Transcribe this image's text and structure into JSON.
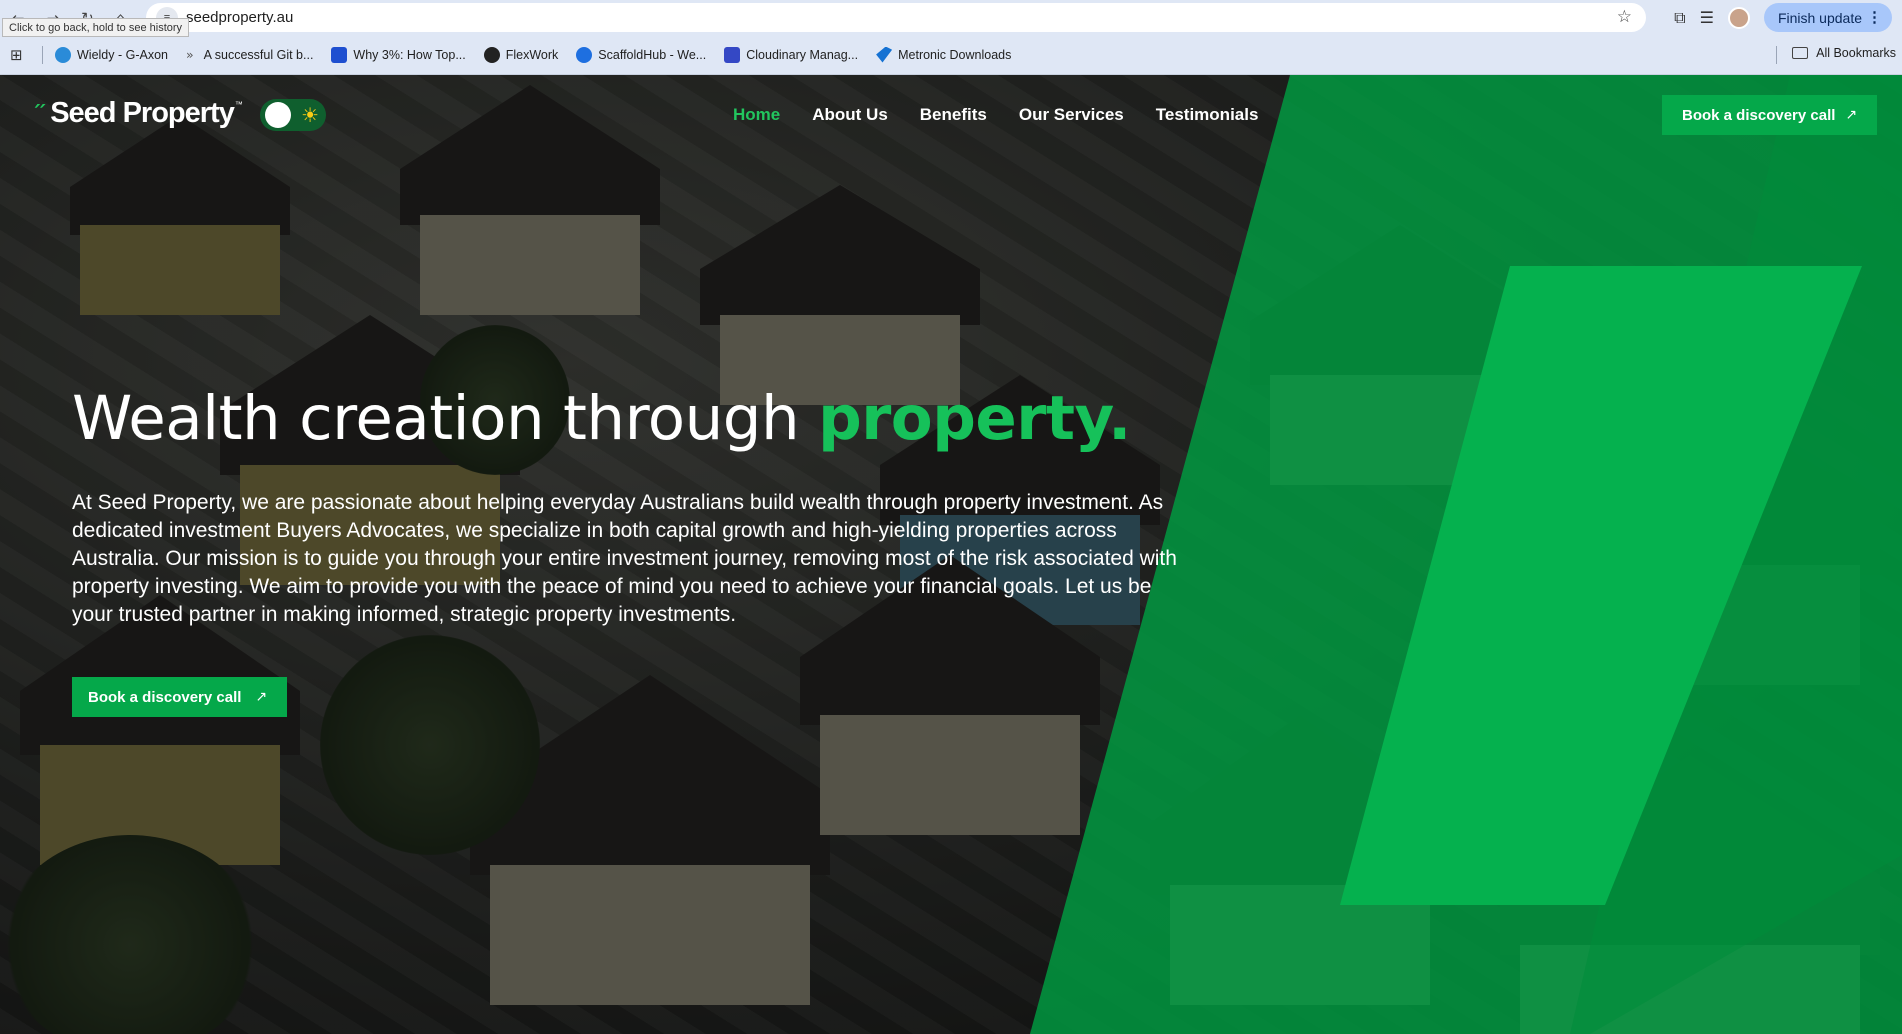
{
  "browser": {
    "url": "seedproperty.au",
    "tooltip": "Click to go back, hold to see history",
    "finish_update_label": "Finish update",
    "bookmarks": [
      {
        "label": "Wieldy - G-Axon",
        "color": "#2a8bd8"
      },
      {
        "label": "A successful Git b...",
        "color": ""
      },
      {
        "label": "Why 3%: How Top...",
        "color": "#1e4fd0"
      },
      {
        "label": "FlexWork",
        "color": "#222222"
      },
      {
        "label": "ScaffoldHub - We...",
        "color": "#1e6fe0"
      },
      {
        "label": "Cloudinary Manag...",
        "color": "#3448c5"
      },
      {
        "label": "Metronic Downloads",
        "color": "#1572d3"
      }
    ],
    "all_bookmarks_label": "All Bookmarks"
  },
  "header": {
    "logo_text": "Seed Property",
    "logo_tm": "™",
    "nav": [
      {
        "label": "Home",
        "active": true
      },
      {
        "label": "About Us",
        "active": false
      },
      {
        "label": "Benefits",
        "active": false
      },
      {
        "label": "Our Services",
        "active": false
      },
      {
        "label": "Testimonials",
        "active": false
      }
    ],
    "cta_label": "Book a discovery call"
  },
  "hero": {
    "title_main": "Wealth creation through ",
    "title_accent": "property.",
    "paragraph": "At Seed Property, we are passionate about helping everyday Australians build wealth through property investment. As dedicated investment Buyers Advocates, we specialize in both capital growth and high-yielding properties across Australia. Our mission is to guide you through your entire investment journey, removing most of the risk associated with property investing. We aim to provide you with the peace of mind you need to achieve your financial goals. Let us be your trusted partner in making informed, strategic property investments.",
    "cta_label": "Book a discovery call"
  },
  "colors": {
    "brand_green": "#05a84a",
    "accent_green": "#16c15a"
  }
}
